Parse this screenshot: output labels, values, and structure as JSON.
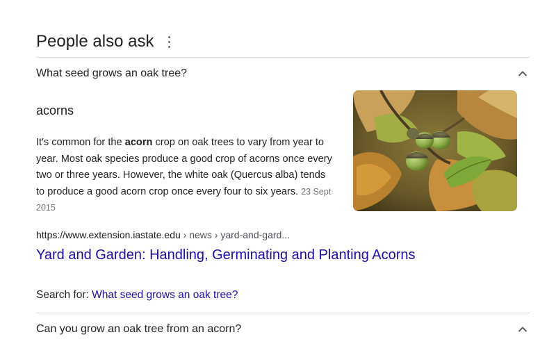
{
  "header": {
    "title": "People also ask",
    "more_icon": "more-vertical-icon"
  },
  "questions": [
    {
      "text": "What seed grows an oak tree?",
      "expanded": true,
      "toggle_icon": "chevron-up-icon"
    },
    {
      "text": "Can you grow an oak tree from an acorn?",
      "expanded": false,
      "toggle_icon": "chevron-up-icon"
    }
  ],
  "answer": {
    "heading": "acorns",
    "snippet_before": "It's common for the ",
    "snippet_bold": "acorn",
    "snippet_after": " crop on oak trees to vary from year to year. Most oak species produce a good crop of acorns once every two or three years. However, the white oak (Quercus alba) tends to produce a good acorn crop once every four to six years.",
    "date": "23 Sept 2015",
    "image": "acorn-photo"
  },
  "source": {
    "url_base": "https://www.extension.iastate.edu",
    "breadcrumbs": " › news › yard-and-gard...",
    "title": "Yard and Garden: Handling, Germinating and Planting Acorns"
  },
  "search_for": {
    "label": "Search for: ",
    "query": "What seed grows an oak tree?"
  },
  "colors": {
    "link": "#1a0dab",
    "text": "#202124",
    "secondary": "#70757a",
    "divider": "#dadce0"
  }
}
